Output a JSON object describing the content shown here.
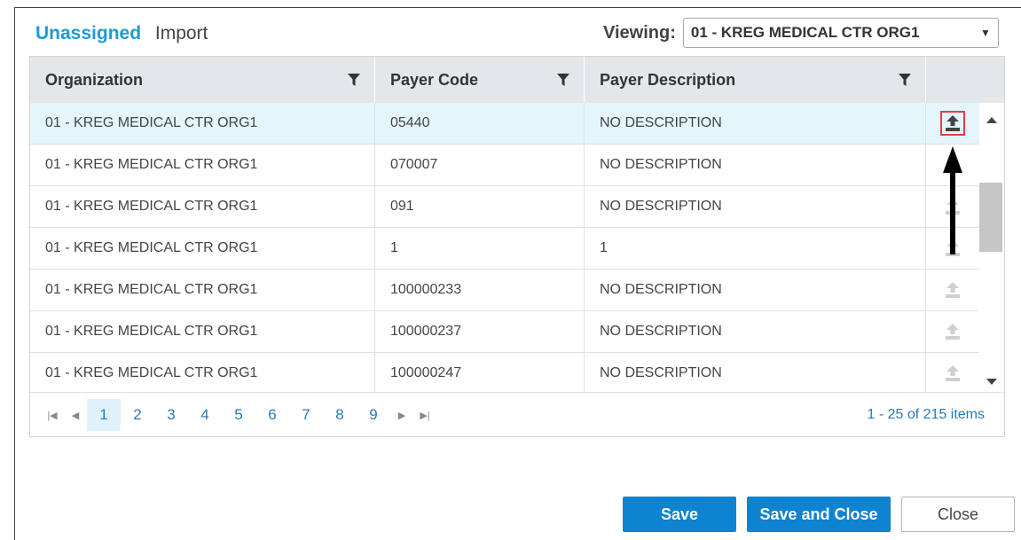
{
  "tabs": {
    "active": "Unassigned",
    "inactive": "Import"
  },
  "viewing": {
    "label": "Viewing:",
    "selected": "01 - KREG MEDICAL CTR ORG1"
  },
  "columns": [
    "Organization",
    "Payer Code",
    "Payer Description"
  ],
  "rows": [
    {
      "org": "01 - KREG MEDICAL CTR ORG1",
      "code": "05440",
      "desc": "NO DESCRIPTION"
    },
    {
      "org": "01 - KREG MEDICAL CTR ORG1",
      "code": "070007",
      "desc": "NO DESCRIPTION"
    },
    {
      "org": "01 - KREG MEDICAL CTR ORG1",
      "code": "091",
      "desc": "NO DESCRIPTION"
    },
    {
      "org": "01 - KREG MEDICAL CTR ORG1",
      "code": "1",
      "desc": "1"
    },
    {
      "org": "01 - KREG MEDICAL CTR ORG1",
      "code": "100000233",
      "desc": "NO DESCRIPTION"
    },
    {
      "org": "01 - KREG MEDICAL CTR ORG1",
      "code": "100000237",
      "desc": "NO DESCRIPTION"
    },
    {
      "org": "01 - KREG MEDICAL CTR ORG1",
      "code": "100000247",
      "desc": "NO DESCRIPTION"
    }
  ],
  "pager": {
    "pages": [
      "1",
      "2",
      "3",
      "4",
      "5",
      "6",
      "7",
      "8",
      "9"
    ],
    "current": "1",
    "info": "1 - 25 of 215 items"
  },
  "buttons": {
    "save": "Save",
    "save_close": "Save and Close",
    "close": "Close"
  },
  "colors": {
    "accent": "#1d9bd1",
    "primary_button": "#0e83d2",
    "selected_row": "#e4f6fb",
    "highlight_box": "#e04040"
  },
  "icons": {
    "filter": "filter-icon",
    "assign": "upload-arrow-icon",
    "pointer": "black-arrow-pointer"
  }
}
